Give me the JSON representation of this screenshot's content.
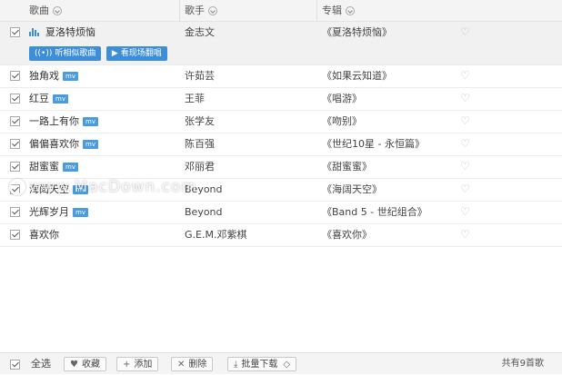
{
  "header": {
    "song": "歌曲",
    "singer": "歌手",
    "album": "专辑"
  },
  "rows": [
    {
      "title": "夏洛特烦恼",
      "mv": false,
      "playing": true,
      "singer": "金志文",
      "album": "《夏洛特烦恼》",
      "actions": [
        {
          "label": "听相似歌曲",
          "icon": "((•))"
        },
        {
          "label": "看现场翻唱",
          "icon": "▶"
        }
      ]
    },
    {
      "title": "独角戏",
      "mv": true,
      "singer": "许茹芸",
      "album": "《如果云知道》"
    },
    {
      "title": "红豆",
      "mv": true,
      "singer": "王菲",
      "album": "《唱游》"
    },
    {
      "title": "一路上有你",
      "mv": true,
      "singer": "张学友",
      "album": "《吻别》"
    },
    {
      "title": "偏偏喜欢你",
      "mv": true,
      "singer": "陈百强",
      "album": "《世纪10星 - 永恒篇》"
    },
    {
      "title": "甜蜜蜜",
      "mv": true,
      "singer": "邓丽君",
      "album": "《甜蜜蜜》"
    },
    {
      "title": "海阔天空",
      "mv": true,
      "singer": "Beyond",
      "album": "《海阔天空》"
    },
    {
      "title": "光辉岁月",
      "mv": true,
      "singer": "Beyond",
      "album": "《Band 5 - 世纪组合》"
    },
    {
      "title": "喜欢你",
      "mv": false,
      "singer": "G.E.M.邓紫棋",
      "album": "《喜欢你》"
    }
  ],
  "mv_badge": "mv",
  "footer": {
    "select_all": "全选",
    "collect": "收藏",
    "add": "添加",
    "delete": "删除",
    "batch_download": "批量下载",
    "total": "共有9首歌"
  },
  "watermark": "www.MacDown.com",
  "colors": {
    "accent": "#3d8ed8",
    "header_bg": "#f4f4f4"
  }
}
